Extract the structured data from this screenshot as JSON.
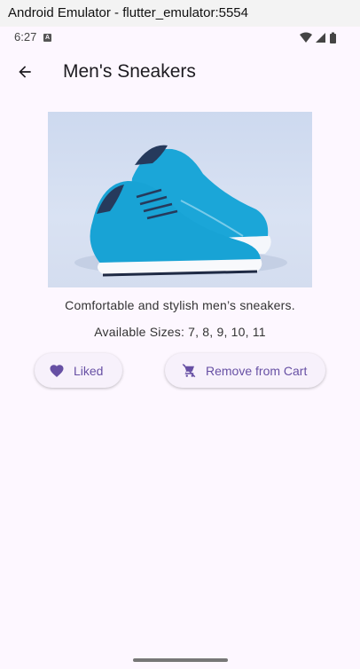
{
  "window": {
    "title": "Android Emulator - flutter_emulator:5554"
  },
  "status_bar": {
    "time": "6:27",
    "notification_icon": "a-icon",
    "icons": [
      "wifi-icon",
      "signal-icon",
      "battery-icon"
    ]
  },
  "app_bar": {
    "title": "Men's Sneakers",
    "back_icon": "arrow-back-icon"
  },
  "product": {
    "image_alt": "product-photo",
    "description": "Comfortable and stylish men’s sneakers.",
    "sizes": "Available Sizes: 7, 8, 9, 10, 11"
  },
  "actions": {
    "liked_label": "Liked",
    "liked_icon": "heart-icon",
    "cart_label": "Remove from Cart",
    "cart_icon": "remove-shopping-cart-icon"
  },
  "colors": {
    "background": "#fdf7ff",
    "accent": "#6750a4",
    "shoe": "#1ba6d8"
  }
}
